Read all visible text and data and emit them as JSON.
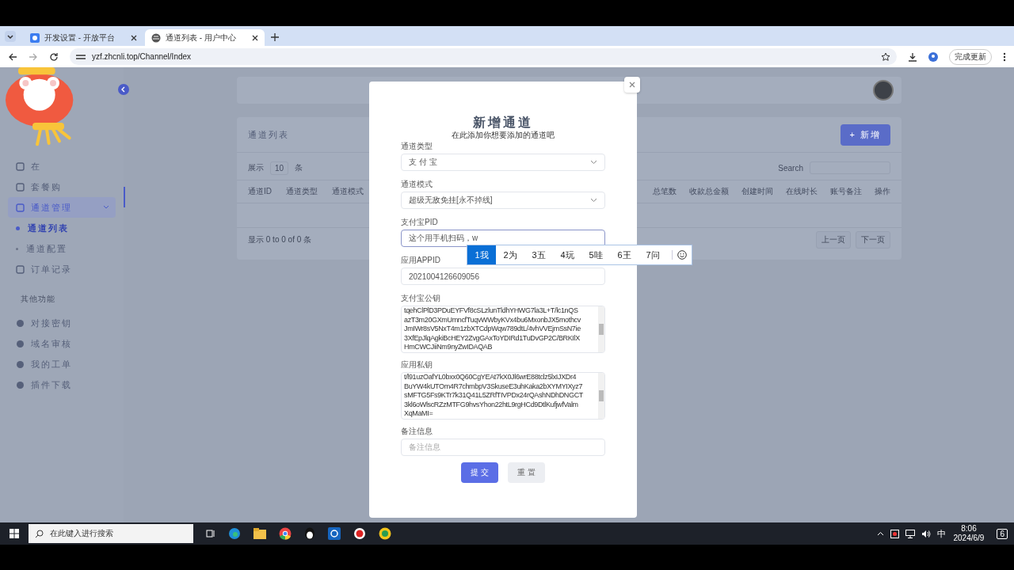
{
  "browser": {
    "tabs": [
      {
        "title": "开发设置 - 开放平台",
        "selected": false
      },
      {
        "title": "通道列表 - 用户中心",
        "selected": true
      }
    ],
    "url": "yzf.zhcnli.top/Channel/Index",
    "update_button": "完成更新"
  },
  "sidebar": {
    "items": [
      {
        "label": "在",
        "selected": false
      },
      {
        "label": "套餐购",
        "selected": false
      },
      {
        "label": "通道管理",
        "selected": true,
        "expanded": true,
        "children": [
          {
            "label": "通道列表",
            "selected": true
          },
          {
            "label": "通道配置",
            "selected": false
          }
        ]
      },
      {
        "label": "订单记录",
        "selected": false
      }
    ],
    "section": "其他功能",
    "extra_items": [
      {
        "label": "对接密钥"
      },
      {
        "label": "域名审核"
      },
      {
        "label": "我的工单"
      },
      {
        "label": "插件下载"
      }
    ]
  },
  "card": {
    "title": "通道列表",
    "add_button": "+ 新增",
    "show_label": "展示",
    "page_size": "10",
    "rows_label": "条",
    "search_label": "Search",
    "columns_left": [
      "通道ID",
      "通道类型",
      "通道模式"
    ],
    "columns_right": [
      "总笔数",
      "收款总金额",
      "创建时间",
      "在线时长",
      "账号备注",
      "操作"
    ],
    "info": "显示 0 to 0 of 0 条",
    "prev": "上一页",
    "next": "下一页"
  },
  "modal": {
    "title": "新增通道",
    "subtitle": "在此添加你想要添加的通道吧",
    "fields": [
      {
        "kind": "select",
        "label": "通道类型",
        "value": "支 付 宝"
      },
      {
        "kind": "select",
        "label": "通道模式",
        "value": "超级无敌免挂[永不掉线]"
      },
      {
        "kind": "input",
        "label": "支付宝PID",
        "value": "这个用手机扫码，w",
        "focused": true
      },
      {
        "kind": "input",
        "label": "应用APPID",
        "value": "2021004126609056",
        "focused": false
      },
      {
        "kind": "textarea",
        "label": "支付宝公钥",
        "lines": [
          "tqehClPlD3PDuEYFVf8cSLzlunTldhYHWG7la3L+T/lc1nQS",
          "azT3m20GXmUmncfTuqvWWbyKVx4bu6MxonbJX5mothcv",
          "JmIWr8sV5NxT4m1zbXTCdpWqw789dtL/4vhVVEjmSsN7ie",
          "3XfEpJlqAgkiBcHEY2ZvgGAxToYDIRd1TuDvGP2C/BRKIlX",
          "HmCWCJiiNm9nyZwIDAQAB"
        ]
      },
      {
        "kind": "textarea",
        "label": "应用私钥",
        "lines": [
          "t/l91uzOafYL0bxx0Q60CgYEAt7kX0Jl6wrE88tclz5lxIJXDr4",
          "BuYW4kUTOm4R7chmbpV3SkuseE3uhKaka2bXYMYIXyz7",
          "sMFTG5Fs9KTr7k31Q41L5ZRfTIVPDx24rQAshNDhDNGCT",
          "3kl6oWlscRZzMTFG9hvsYhon22htL9rgHCd9DtlKufjwfValm",
          "XqMaMI="
        ]
      },
      {
        "kind": "placeholder",
        "label": "备注信息",
        "placeholder": "备注信息"
      }
    ],
    "submit": "提 交",
    "reset": "重 置"
  },
  "ime": {
    "candidates": [
      {
        "text": "1我",
        "selected": true
      },
      {
        "text": "2为",
        "selected": false
      },
      {
        "text": "3五",
        "selected": false
      },
      {
        "text": "4玩",
        "selected": false
      },
      {
        "text": "5哇",
        "selected": false
      },
      {
        "text": "6王",
        "selected": false
      },
      {
        "text": "7问",
        "selected": false
      }
    ]
  },
  "taskbar": {
    "search": "在此键入进行搜索",
    "ime": "中",
    "time": "8:06",
    "date": "2024/6/9",
    "notifications": "6"
  }
}
